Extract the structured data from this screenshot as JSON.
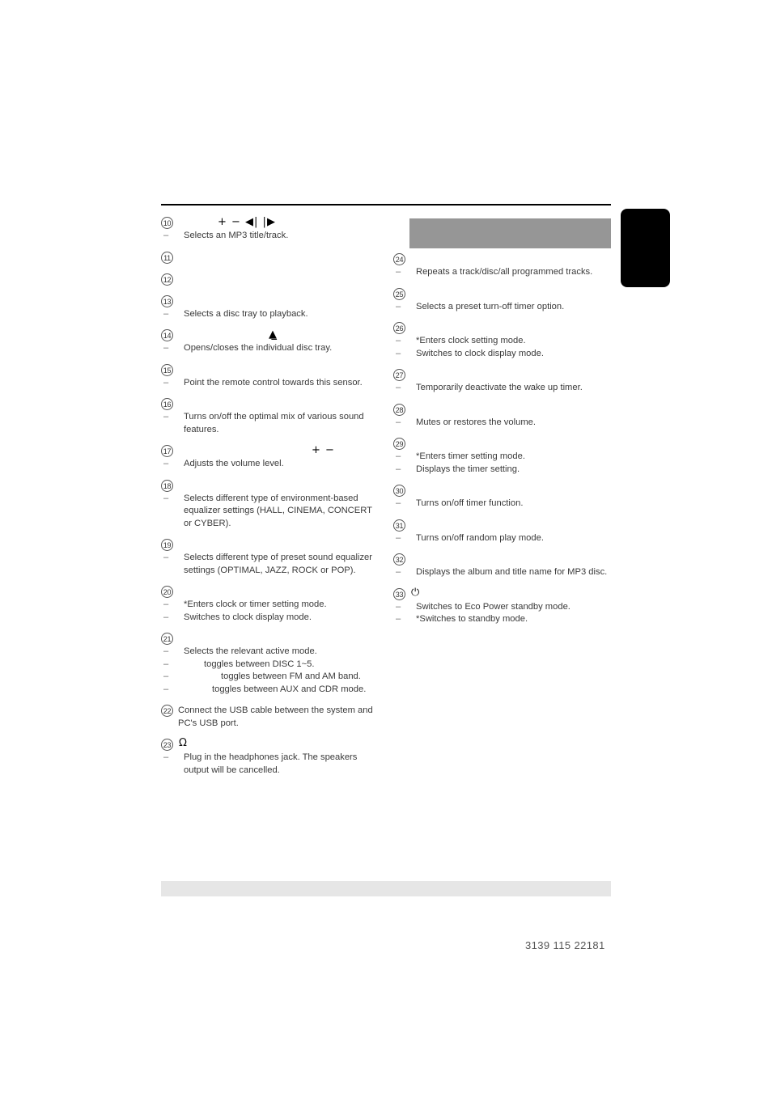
{
  "document": {
    "footer_code": "3139 115 22181"
  },
  "colors": {
    "rule": "#000000",
    "thumb_tab": "#000000",
    "gray_block": "#969696",
    "bottom_bar": "#e6e6e6",
    "text": "#3a3a3a"
  },
  "symbols": {
    "plus": "+",
    "minus": "−",
    "prev_track": "⏮",
    "next_track": "⏭",
    "eject": "⏏",
    "headphones": "Ω",
    "power": "⏻"
  },
  "left_column": [
    {
      "number": "10",
      "head_symbols": "+ −   ◀| |▶",
      "head_symbols_pos": "at-70",
      "lines": [
        {
          "dash": "–",
          "text": "Selects an MP3 title/track.",
          "indent": ""
        }
      ]
    },
    {
      "number": "11",
      "head_symbols": "",
      "lines": []
    },
    {
      "number": "12",
      "head_symbols": "",
      "lines": []
    },
    {
      "number": "13",
      "head_symbols": "",
      "lines": [
        {
          "dash": "–",
          "text": "Selects a disc tray to playback.",
          "indent": ""
        }
      ]
    },
    {
      "number": "14",
      "head_symbols": "▲̲",
      "head_symbols_pos": "at-133",
      "lines": [
        {
          "dash": "–",
          "text": "Opens/closes the individual disc tray.",
          "indent": ""
        }
      ]
    },
    {
      "number": "15",
      "head_symbols": "",
      "lines": [
        {
          "dash": "–",
          "text": "Point the remote control towards this sensor.",
          "indent": ""
        }
      ]
    },
    {
      "number": "16",
      "head_symbols": "",
      "lines": [
        {
          "dash": "–",
          "text": "Turns on/off the optimal mix of various sound features.",
          "indent": ""
        }
      ]
    },
    {
      "number": "17",
      "head_symbols": "+ −",
      "head_symbols_pos": "at-186",
      "lines": [
        {
          "dash": "–",
          "text": "Adjusts the volume level.",
          "indent": ""
        }
      ]
    },
    {
      "number": "18",
      "head_symbols": "",
      "lines": [
        {
          "dash": "–",
          "text": "Selects different type of environment-based equalizer settings (HALL, CINEMA, CONCERT or CYBER).",
          "indent": ""
        }
      ]
    },
    {
      "number": "19",
      "head_symbols": "",
      "lines": [
        {
          "dash": "–",
          "text": "Selects different type of preset sound equalizer settings (OPTIMAL, JAZZ, ROCK or POP).",
          "indent": ""
        }
      ]
    },
    {
      "number": "20",
      "head_symbols": "",
      "lines": [
        {
          "dash": "–",
          "text": "*Enters clock or timer setting mode.",
          "indent": ""
        },
        {
          "dash": "–",
          "text": "Switches to clock display mode.",
          "indent": ""
        }
      ]
    },
    {
      "number": "21",
      "head_symbols": "",
      "lines": [
        {
          "dash": "–",
          "text": "Selects the relevant active mode.",
          "indent": ""
        },
        {
          "dash": "–",
          "text": "toggles between DISC 1~5.",
          "indent": "ind-1"
        },
        {
          "dash": "–",
          "text": "toggles between FM and AM band.",
          "indent": "ind-2"
        },
        {
          "dash": "–",
          "text": "toggles between AUX and CDR mode.",
          "indent": "ind-3"
        }
      ]
    },
    {
      "number": "22",
      "head_symbols": "",
      "paragraph": "Connect the USB cable between the system and PC's USB port.",
      "lines": []
    },
    {
      "number": "23",
      "head_symbols": "",
      "inline_icon": "Ω",
      "lines": [
        {
          "dash": "–",
          "text": "Plug in the headphones jack. The speakers output will be cancelled.",
          "indent": ""
        }
      ]
    }
  ],
  "right_column": [
    {
      "number": "24",
      "head_symbols": "",
      "lines": [
        {
          "dash": "–",
          "text": "Repeats a track/disc/all programmed tracks.",
          "indent": ""
        }
      ]
    },
    {
      "number": "25",
      "head_symbols": "",
      "lines": [
        {
          "dash": "–",
          "text": "Selects a preset turn-off timer option.",
          "indent": ""
        }
      ]
    },
    {
      "number": "26",
      "head_symbols": "",
      "lines": [
        {
          "dash": "–",
          "text": "*Enters clock setting mode.",
          "indent": ""
        },
        {
          "dash": "–",
          "text": "Switches to clock display mode.",
          "indent": ""
        }
      ]
    },
    {
      "number": "27",
      "head_symbols": "",
      "lines": [
        {
          "dash": "–",
          "text": "Temporarily deactivate the wake up timer.",
          "indent": ""
        }
      ]
    },
    {
      "number": "28",
      "head_symbols": "",
      "lines": [
        {
          "dash": "–",
          "text": "Mutes or restores the volume.",
          "indent": ""
        }
      ]
    },
    {
      "number": "29",
      "head_symbols": "",
      "lines": [
        {
          "dash": "–",
          "text": "*Enters timer setting mode.",
          "indent": ""
        },
        {
          "dash": "–",
          "text": "Displays the timer setting.",
          "indent": ""
        }
      ]
    },
    {
      "number": "30",
      "head_symbols": "",
      "lines": [
        {
          "dash": "–",
          "text": "Turns on/off timer function.",
          "indent": ""
        }
      ]
    },
    {
      "number": "31",
      "head_symbols": "",
      "lines": [
        {
          "dash": "–",
          "text": "Turns on/off random play mode.",
          "indent": ""
        }
      ]
    },
    {
      "number": "32",
      "head_symbols": "",
      "lines": [
        {
          "dash": "–",
          "text": "Displays the album and title name for MP3 disc.",
          "indent": ""
        }
      ]
    },
    {
      "number": "33",
      "head_symbols": "",
      "inline_icon": "⏻",
      "lines": [
        {
          "dash": "–",
          "text": "Switches to Eco Power standby mode.",
          "indent": ""
        },
        {
          "dash": "–",
          "text": "*Switches to standby mode.",
          "indent": ""
        }
      ]
    }
  ]
}
